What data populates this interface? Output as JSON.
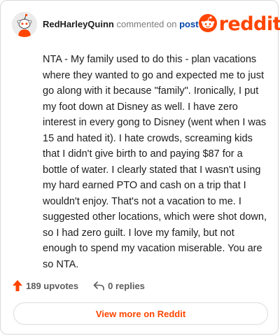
{
  "header": {
    "username": "RedHarleyQuinn",
    "action_text": "commented on",
    "post_link": "post",
    "logo_text": "reddit",
    "avatar_icon": "reddit-avatar-icon",
    "logo_icon": "reddit-snoo-icon"
  },
  "comment": {
    "text": "NTA - My family used to do this - plan vacations where they wanted to go and expected me to just go along with it because \"family\". Ironically, I put my foot down at Disney as well. I have zero interest in every gong to Disney (went when I was 15 and hated it). I hate crowds, screaming kids that I didn't give birth to and paying $87 for a bottle of water. I clearly stated that I wasn't using my hard earned PTO and cash on a trip that I wouldn't enjoy. That's not a vacation to me. I suggested other locations, which were shot down, so I had zero guilt. I love my family, but not enough to spend my vacation miserable. You are so NTA."
  },
  "actions": {
    "upvotes_label": "189 upvotes",
    "replies_label": "0 replies",
    "upvote_icon": "upvote-arrow-icon",
    "reply_icon": "reply-arrow-icon"
  },
  "footer": {
    "view_more_label": "View more on Reddit"
  },
  "colors": {
    "brand": "#ff4500",
    "link": "#0045ac",
    "muted": "#7c7c7c"
  }
}
